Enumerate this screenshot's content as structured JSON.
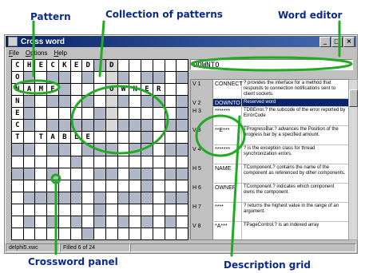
{
  "annotations": {
    "pattern": "Pattern",
    "collection": "Collection of patterns",
    "word_editor": "Word editor",
    "crossword_panel": "Crossword panel",
    "description_grid": "Description grid"
  },
  "window": {
    "title": "Cross word",
    "minimize": "_",
    "maximize": "□",
    "close": "×"
  },
  "menu": [
    "File",
    "Options",
    "Help"
  ],
  "editor": {
    "value": "DOWNTO"
  },
  "crossword": {
    "letters": {
      "0": [
        "C",
        "H",
        "E",
        "C",
        "K",
        "E",
        "D",
        "",
        "D"
      ],
      "1": [
        "O"
      ],
      "2": [
        "N",
        "A",
        "M",
        "E",
        "",
        "",
        "",
        "",
        "O",
        "W",
        "N",
        "E",
        "R"
      ],
      "3": [
        "N"
      ],
      "4": [
        "E"
      ],
      "5": [
        "C"
      ],
      "6": [
        "T",
        "",
        "T",
        "A",
        "B",
        "L",
        "E"
      ]
    }
  },
  "descriptions": [
    {
      "id": "V 1",
      "word": "CONNECT",
      "text": "? provides the interface for a method that responds to connection notifications sent to client sockets."
    },
    {
      "id": "V 2",
      "word": "DOWNTO",
      "text": "Reserved word",
      "highlight": true
    },
    {
      "id": "H 3",
      "word": "*******",
      "text": "TDBError.? the subcode of the error reported by ErrorCode"
    },
    {
      "id": "V 3",
      "word": "**E***",
      "text": "TProgressBar.? advances the Position of the progress bar by a specified amount."
    },
    {
      "id": "V 4",
      "word": "*******",
      "text": "? is the exception class for thread synchronization errors."
    },
    {
      "id": "H 5",
      "word": "NAME",
      "text": "TComponent.? contains the name of the component as referenced by other components."
    },
    {
      "id": "H 6",
      "word": "OWNER",
      "text": "TComponent.? indicates which component owns the component."
    },
    {
      "id": "H 7",
      "word": "****",
      "text": "? returns the highest value in the range of an argument."
    },
    {
      "id": "V 8",
      "word": "*A***",
      "text": "TPageControl.? is an indexed array"
    }
  ],
  "status": {
    "file": "delphi5.xwc",
    "filled": "Filled 6 of 24"
  },
  "colors": {
    "annotation": "#0b2a8c",
    "arrows": "#22aa22",
    "title": "#0a246a"
  }
}
